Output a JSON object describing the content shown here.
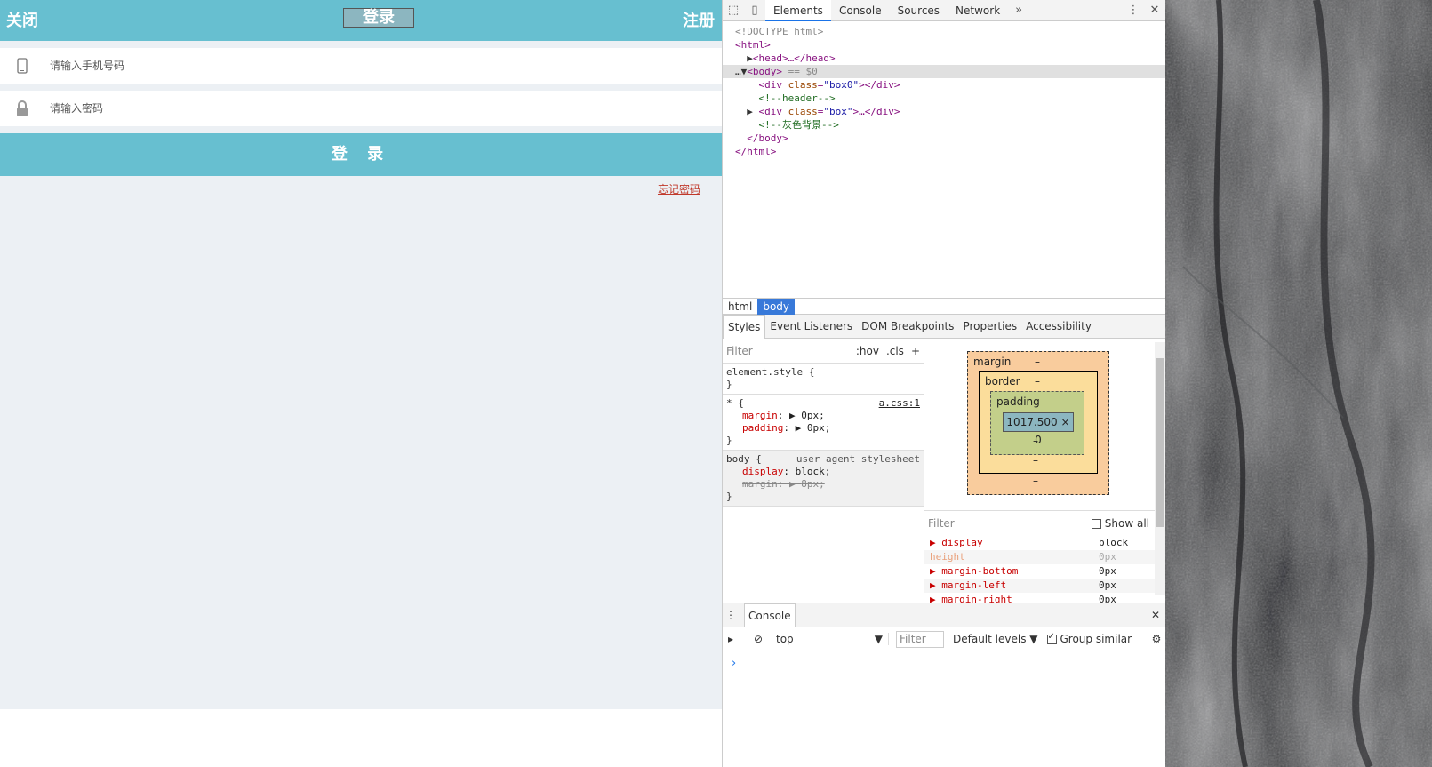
{
  "app": {
    "header": {
      "close": "关闭",
      "title": "登录",
      "register": "注册"
    },
    "phone_placeholder": "请输入手机号码",
    "password_placeholder": "请输入密码",
    "login_button": "登 录",
    "forgot": "忘记密码"
  },
  "devtools": {
    "tabs": [
      "Elements",
      "Console",
      "Sources",
      "Network"
    ],
    "dom": {
      "doctype": "<!DOCTYPE html>",
      "html_open": "<html>",
      "head": "<head>…</head>",
      "body_open": "<body>",
      "body_marker": "== $0",
      "div0_class": "box0",
      "comment_header": "<!--header-->",
      "div_box_class": "box",
      "comment_gray": "<!--灰色背景-->",
      "body_close": "</body>",
      "html_close": "</html>"
    },
    "breadcrumbs": [
      "html",
      "body"
    ],
    "subtabs": [
      "Styles",
      "Event Listeners",
      "DOM Breakpoints",
      "Properties",
      "Accessibility"
    ],
    "styles": {
      "filter_placeholder": "Filter",
      "hov": ":hov",
      "cls": ".cls",
      "plus": "+",
      "element_style": "element.style {",
      "close_brace": "}",
      "star_selector": "* {",
      "star_source": "a.css:1",
      "margin_prop": "margin",
      "margin_val": "0px;",
      "padding_prop": "padding",
      "padding_val": "0px;",
      "body_selector": "body {",
      "ua_label": "user agent stylesheet",
      "display_prop": "display",
      "display_val": "block;",
      "margin_ua_prop": "margin",
      "margin_ua_val": "8px;"
    },
    "boxmodel": {
      "margin": "margin",
      "border": "border",
      "padding": "padding",
      "dash": "–",
      "content": "1017.500 × 0"
    },
    "computed": {
      "filter": "Filter",
      "show_all": "Show all",
      "rows": [
        {
          "name": "display",
          "value": "block"
        },
        {
          "name": "height",
          "value": "0px"
        },
        {
          "name": "margin-bottom",
          "value": "0px"
        },
        {
          "name": "margin-left",
          "value": "0px"
        },
        {
          "name": "margin-right",
          "value": "0px"
        }
      ]
    },
    "drawer": {
      "tab": "Console",
      "context": "top",
      "filter": "Filter",
      "levels": "Default levels",
      "group": "Group similar",
      "prompt": "›"
    }
  }
}
